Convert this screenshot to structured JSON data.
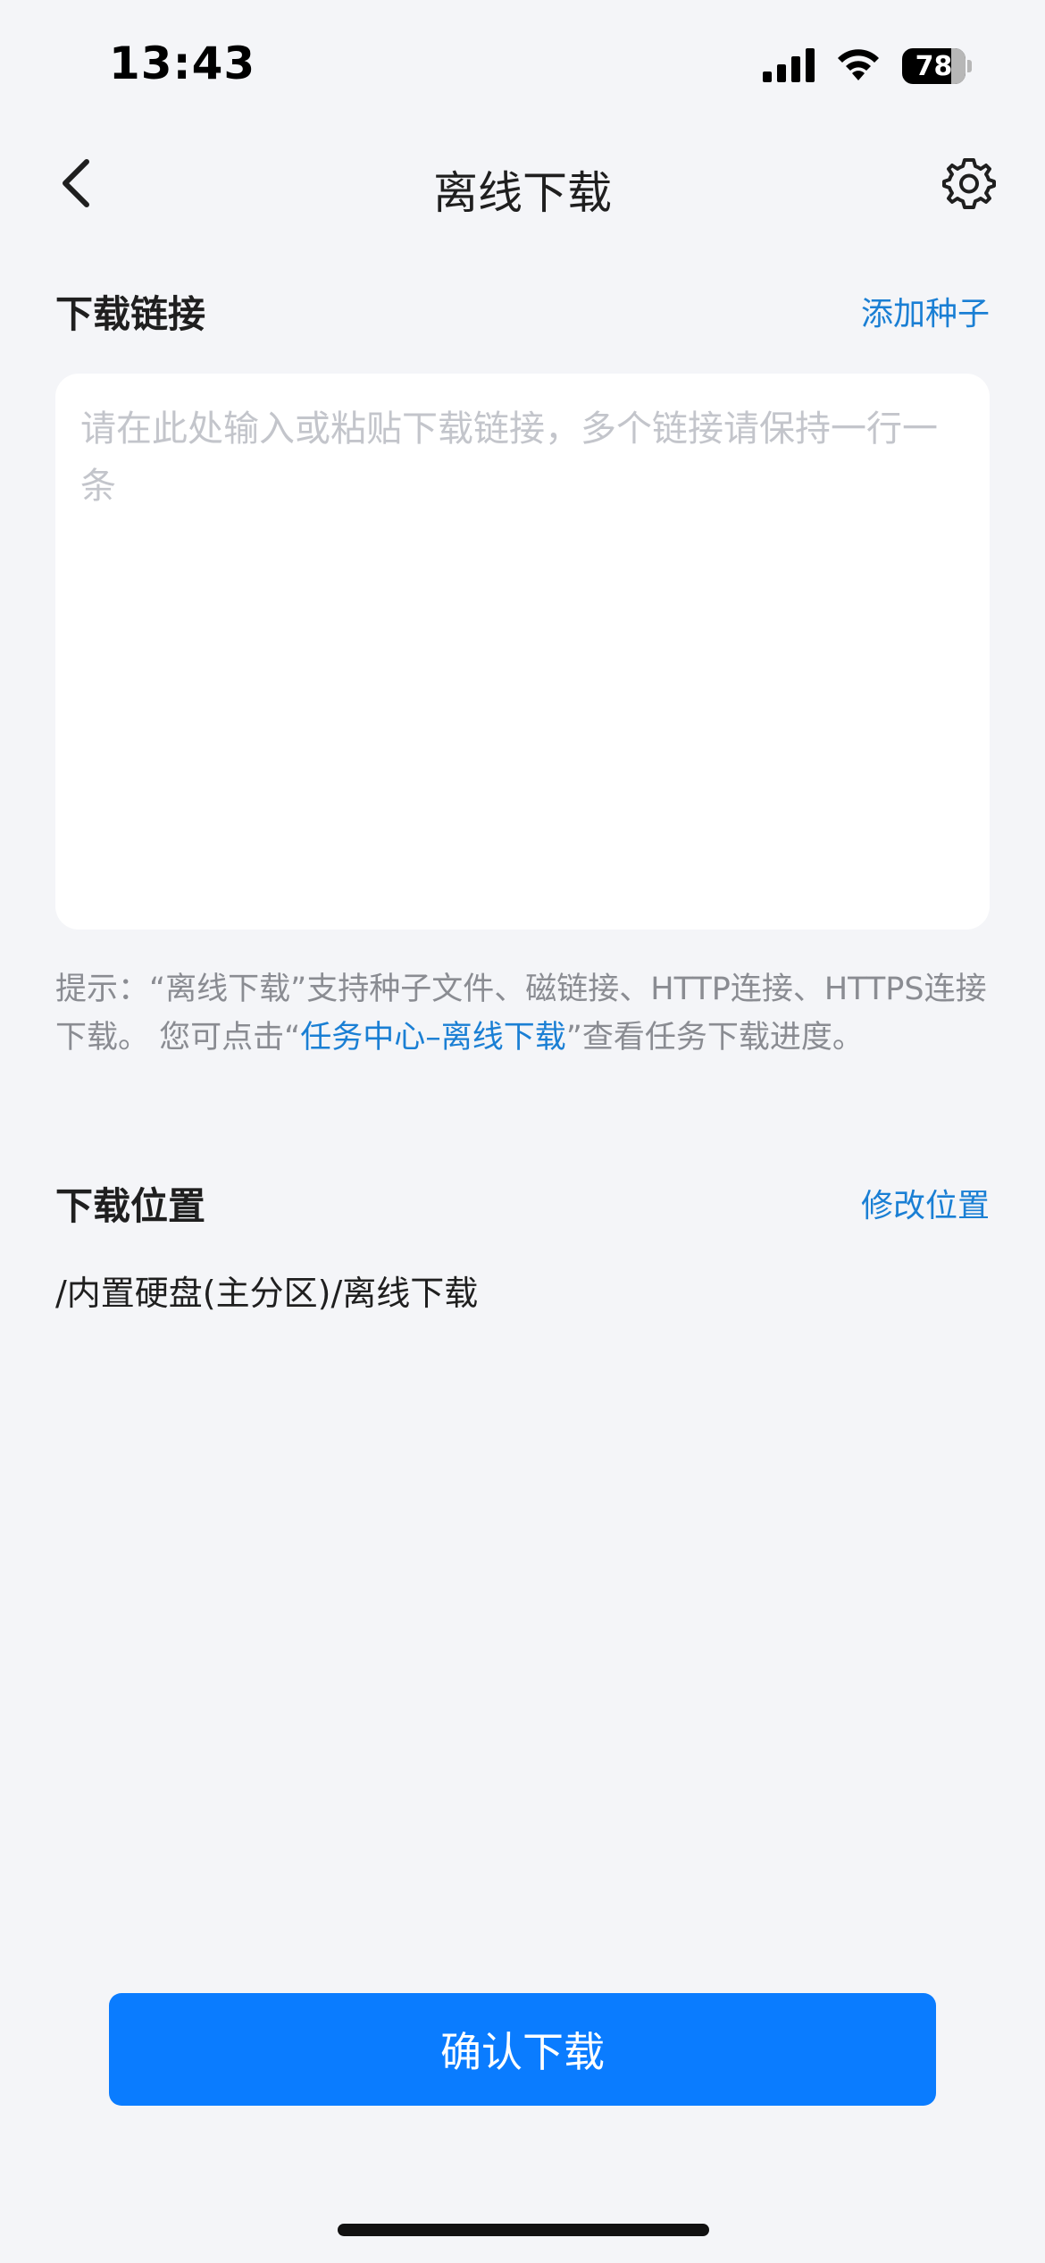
{
  "status_bar": {
    "time": "13:43",
    "battery_level": "78",
    "icons": [
      "signal-icon",
      "wifi-icon",
      "battery-icon"
    ]
  },
  "nav": {
    "title": "离线下载",
    "back_icon": "chevron-left-icon",
    "settings_icon": "gear-icon"
  },
  "link_section": {
    "title": "下载链接",
    "action": "添加种子",
    "input_value": "",
    "input_placeholder": "请在此处输入或粘贴下载链接，多个链接请保持一行一条"
  },
  "hint": {
    "prefix": "提示：“离线下载”支持种子文件、磁链接、HTTP连接、HTTPS连接下载。 您可点击“",
    "link": "任务中心–离线下载",
    "suffix": "”查看任务下载进度。"
  },
  "location_section": {
    "title": "下载位置",
    "action": "修改位置",
    "path": "/内置硬盘(主分区)/离线下载"
  },
  "confirm_button": {
    "label": "确认下载"
  },
  "colors": {
    "background": "#f4f5f8",
    "accent": "#1a7fd4",
    "primary_button": "#0a7cff",
    "hint_text": "#8a8c92"
  }
}
